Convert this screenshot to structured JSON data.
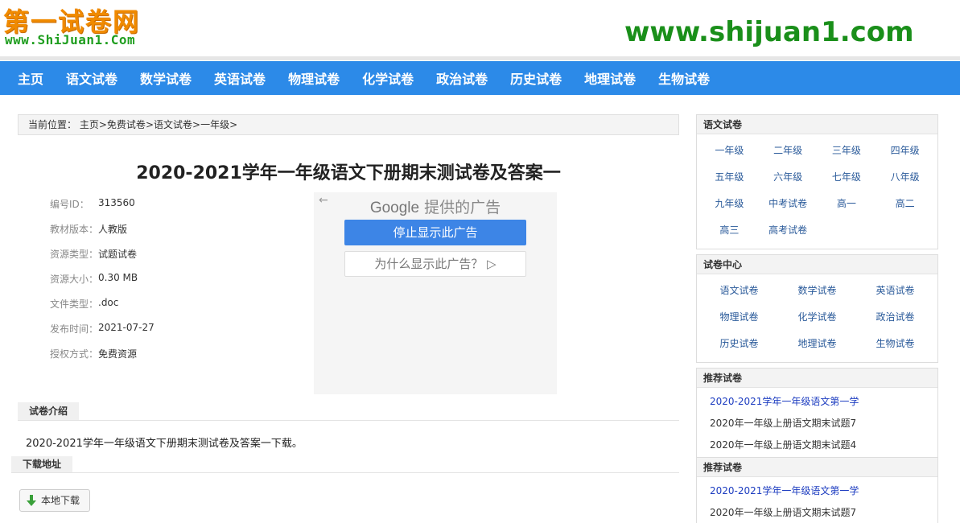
{
  "header": {
    "logo_cn": "第一试卷网",
    "logo_en": "www.ShiJuan1.Com",
    "site_url": "www.shijuan1.com"
  },
  "nav": [
    "主页",
    "语文试卷",
    "数学试卷",
    "英语试卷",
    "物理试卷",
    "化学试卷",
    "政治试卷",
    "历史试卷",
    "地理试卷",
    "生物试卷"
  ],
  "breadcrumb": {
    "prefix": "当前位置：",
    "items": [
      "主页",
      "免费试卷",
      "语文试卷",
      "一年级"
    ],
    "sep": ">"
  },
  "title": "2020-2021学年一年级语文下册期末测试卷及答案一",
  "meta": [
    {
      "key": "编号ID：",
      "value": "313560"
    },
    {
      "key": "教材版本：",
      "value": "人教版"
    },
    {
      "key": "资源类型：",
      "value": "试题试卷"
    },
    {
      "key": "资源大小：",
      "value": "0.30 MB"
    },
    {
      "key": "文件类型：",
      "value": ".doc"
    },
    {
      "key": "发布时间：",
      "value": "2021-07-27"
    },
    {
      "key": "授权方式：",
      "value": "免费资源"
    }
  ],
  "ad": {
    "back": "←",
    "google": "Google",
    "head_suffix": " 提供的广告",
    "stop": "停止显示此广告",
    "why": "为什么显示此广告？ ▷"
  },
  "intro": {
    "label": "试卷介绍",
    "text": "2020-2021学年一年级语文下册期末测试卷及答案一下载。"
  },
  "download": {
    "label": "下载地址",
    "button": "本地下载"
  },
  "sidebar": {
    "yuwen": {
      "title": "语文试卷",
      "items": [
        "一年级",
        "二年级",
        "三年级",
        "四年级",
        "五年级",
        "六年级",
        "七年级",
        "八年级",
        "九年级",
        "中考试卷",
        "高一",
        "高二",
        "高三",
        "高考试卷"
      ]
    },
    "center": {
      "title": "试卷中心",
      "items": [
        "语文试卷",
        "数学试卷",
        "英语试卷",
        "物理试卷",
        "化学试卷",
        "政治试卷",
        "历史试卷",
        "地理试卷",
        "生物试卷"
      ]
    },
    "rec1": {
      "title": "推荐试卷",
      "items": [
        "2020-2021学年一年级语文第一学",
        "2020年一年级上册语文期末试题7",
        "2020年一年级上册语文期末试题4"
      ]
    },
    "rec2": {
      "title": "推荐试卷",
      "items": [
        "2020-2021学年一年级语文第一学",
        "2020年一年级上册语文期末试题7"
      ]
    }
  }
}
